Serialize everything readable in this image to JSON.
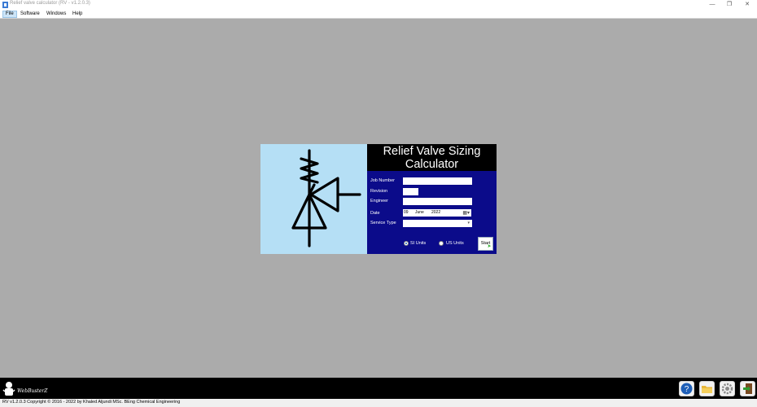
{
  "window": {
    "title": "Relief valve calculator (RV - v1.2.0.3)",
    "minimize_glyph": "—",
    "maximize_glyph": "❐",
    "close_glyph": "✕"
  },
  "menu": {
    "items": [
      {
        "label": "File"
      },
      {
        "label": "Software"
      },
      {
        "label": "Windows"
      },
      {
        "label": "Help"
      }
    ]
  },
  "dialog": {
    "header_line1": "Relief Valve Sizing",
    "header_line2": "Calculator",
    "labels": {
      "job_number": "Job Number",
      "revision": "Revision",
      "engineer": "Engineer",
      "date": "Date",
      "service_type": "Service Type"
    },
    "values": {
      "job_number": "",
      "revision": "",
      "engineer": "",
      "service_type": ""
    },
    "date": {
      "day": "09",
      "month": "June",
      "year": "2022"
    },
    "units": {
      "si_label": "SI Units",
      "us_label": "US Units",
      "selected": "SI Units"
    },
    "start_label": "Start",
    "icon": "relief-valve-symbol-icon"
  },
  "bottom": {
    "brand_text": "WebBusterZ",
    "tools": [
      {
        "icon": "help-icon"
      },
      {
        "icon": "folder-icon"
      },
      {
        "icon": "settings-icon"
      },
      {
        "icon": "exit-icon"
      }
    ]
  },
  "status": {
    "text": "RV v1.2.0.3  Copyright © 2016 - 2022 by Khaled Aljundi MSc. BEng Chemical Engineering"
  },
  "colors": {
    "workspace": "#ababab",
    "logo_background": "#b5dff5",
    "form_background": "#0b0b8a",
    "header_background": "#000000"
  }
}
